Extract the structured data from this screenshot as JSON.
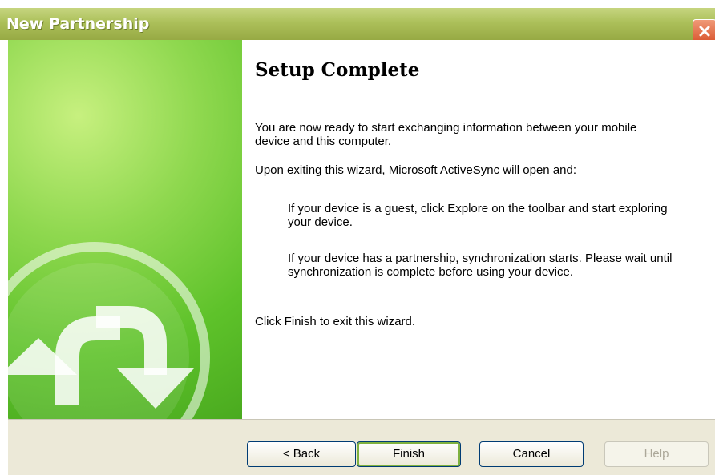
{
  "window": {
    "title": "New Partnership"
  },
  "content": {
    "heading": "Setup Complete",
    "para1": "You are now ready to start exchanging information between your mobile device and this computer.",
    "para2": "Upon exiting this wizard, Microsoft ActiveSync will open and:",
    "para3": "If your device is a guest, click Explore on the toolbar and start exploring your device.",
    "para4": "If your device has a partnership, synchronization starts. Please wait until synchronization is complete before using your device.",
    "para5": "Click Finish to exit this wizard."
  },
  "buttons": {
    "back": "< Back",
    "finish": "Finish",
    "cancel": "Cancel",
    "help": "Help"
  },
  "colors": {
    "title_bar": "#acc05a",
    "side_panel": "#5ec22a",
    "footer": "#ece9d8"
  },
  "icons": [
    "close-icon",
    "sync-arrows-icon"
  ]
}
